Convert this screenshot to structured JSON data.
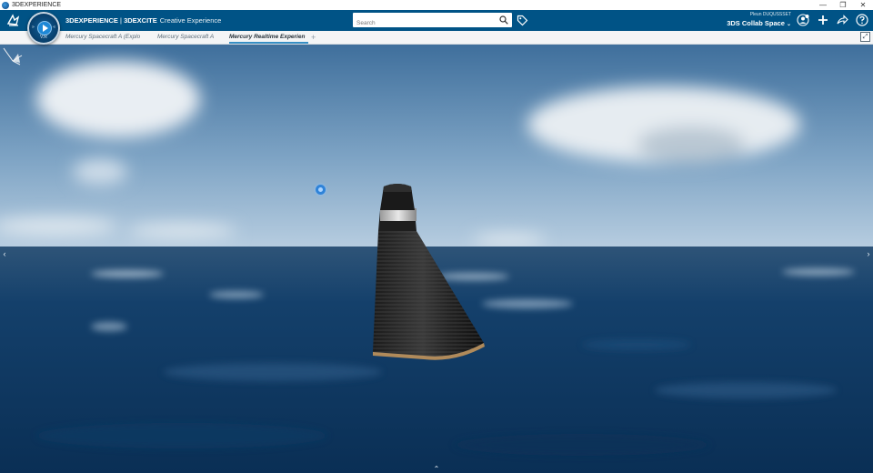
{
  "window": {
    "title": "3DEXPERIENCE",
    "controls": {
      "minimize": "—",
      "maximize": "❐",
      "close": "✕"
    }
  },
  "topbar": {
    "brand_primary": "3DEXPERIENCE",
    "separator": " | ",
    "brand_app": "3DEXCITE",
    "brand_sub": "Creative Experience",
    "compass_version": "V.R",
    "search": {
      "placeholder": "Search",
      "value": ""
    },
    "user_name": "Pleun DUQUSSSET",
    "collab_space": "3DS Collab Space",
    "icons": [
      "ds-logo-icon",
      "compass-icon",
      "search-icon",
      "tag-icon",
      "user-icon",
      "add-icon",
      "share-icon",
      "help-icon"
    ]
  },
  "tabs": [
    {
      "label": "Mercury Spacecraft A (Explo",
      "active": false
    },
    {
      "label": "Mercury Spacecraft A",
      "active": false
    },
    {
      "label": "Mercury Realtime Experien",
      "active": true
    }
  ],
  "tab_add": "+",
  "colors": {
    "topbar": "#005386",
    "accent": "#368ec4",
    "sky_top": "#4e7ea8",
    "sea": "#0e3a63"
  },
  "viewport": {
    "left_arrow": "‹",
    "right_arrow": "›",
    "bottom_arrow": "⌃"
  }
}
